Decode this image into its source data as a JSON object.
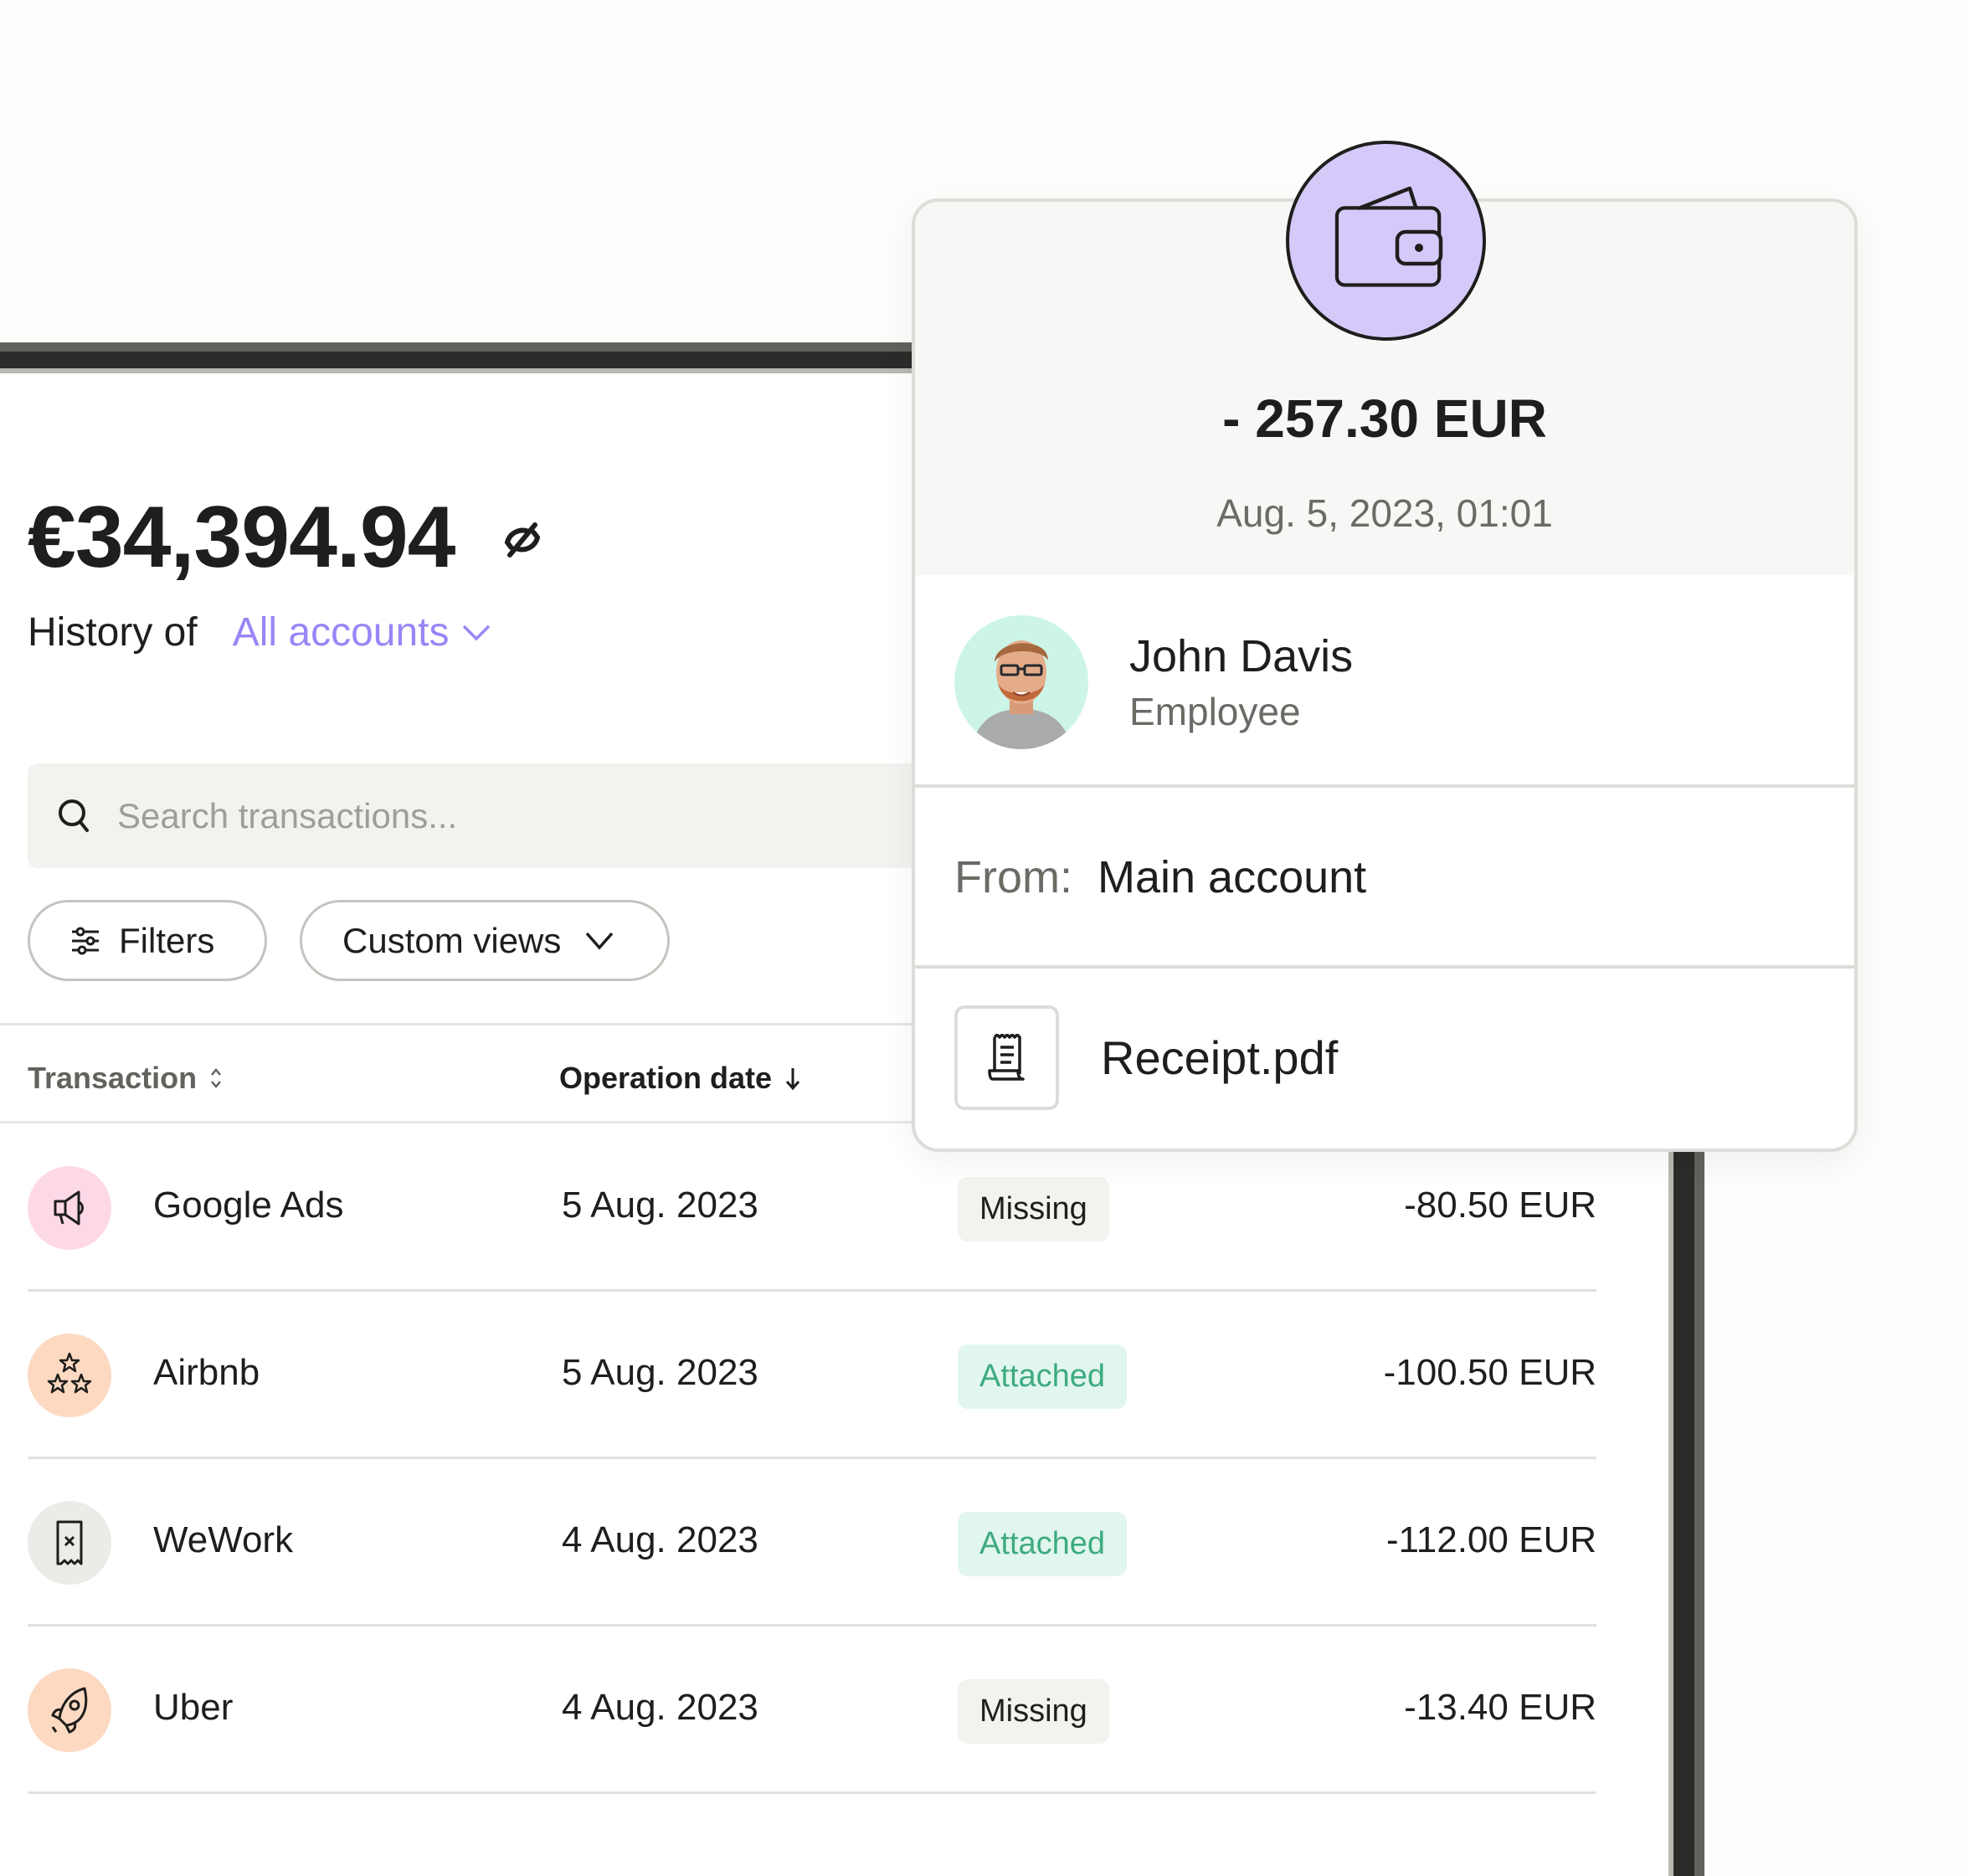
{
  "balance": {
    "amount": "€34,394.94",
    "visibility_icon": "eye-slash-icon"
  },
  "history": {
    "label": "History of",
    "account_selector": "All accounts"
  },
  "search": {
    "placeholder": "Search transactions...",
    "value": ""
  },
  "toolbar": {
    "filters_label": "Filters",
    "custom_views_label": "Custom views"
  },
  "table": {
    "columns": [
      {
        "label": "Transaction",
        "sort": "sortable"
      },
      {
        "label": "Operation date",
        "sort": "descending"
      }
    ],
    "rows": [
      {
        "name": "Google Ads",
        "date": "5 Aug. 2023",
        "receipt_status": "Missing",
        "amount": "-80.50 EUR",
        "icon": "megaphone-icon",
        "icon_bg": "#fdd9e8"
      },
      {
        "name": "Airbnb",
        "date": "5 Aug. 2023",
        "receipt_status": "Attached",
        "amount": "-100.50 EUR",
        "icon": "stars-icon",
        "icon_bg": "#fdd9c2"
      },
      {
        "name": "WeWork",
        "date": "4 Aug. 2023",
        "receipt_status": "Attached",
        "amount": "-112.00 EUR",
        "icon": "receipt-x-icon",
        "icon_bg": "#ebebe8"
      },
      {
        "name": "Uber",
        "date": "4 Aug. 2023",
        "receipt_status": "Missing",
        "amount": "-13.40 EUR",
        "icon": "rocket-icon",
        "icon_bg": "#fdd9c2"
      }
    ]
  },
  "detail_card": {
    "icon": "wallet-icon",
    "amount": "- 257.30 EUR",
    "datetime": "Aug. 5, 2023, 01:01",
    "person": {
      "name": "John Davis",
      "role": "Employee"
    },
    "from_label": "From:",
    "from_value": "Main account",
    "attachment": "Receipt.pdf"
  },
  "colors": {
    "accent": "#9b85f6",
    "wallet_badge": "#d5c9fa",
    "attached_text": "#3dab80",
    "attached_bg": "#e1f6ee",
    "missing_bg": "#f2f2ef"
  }
}
